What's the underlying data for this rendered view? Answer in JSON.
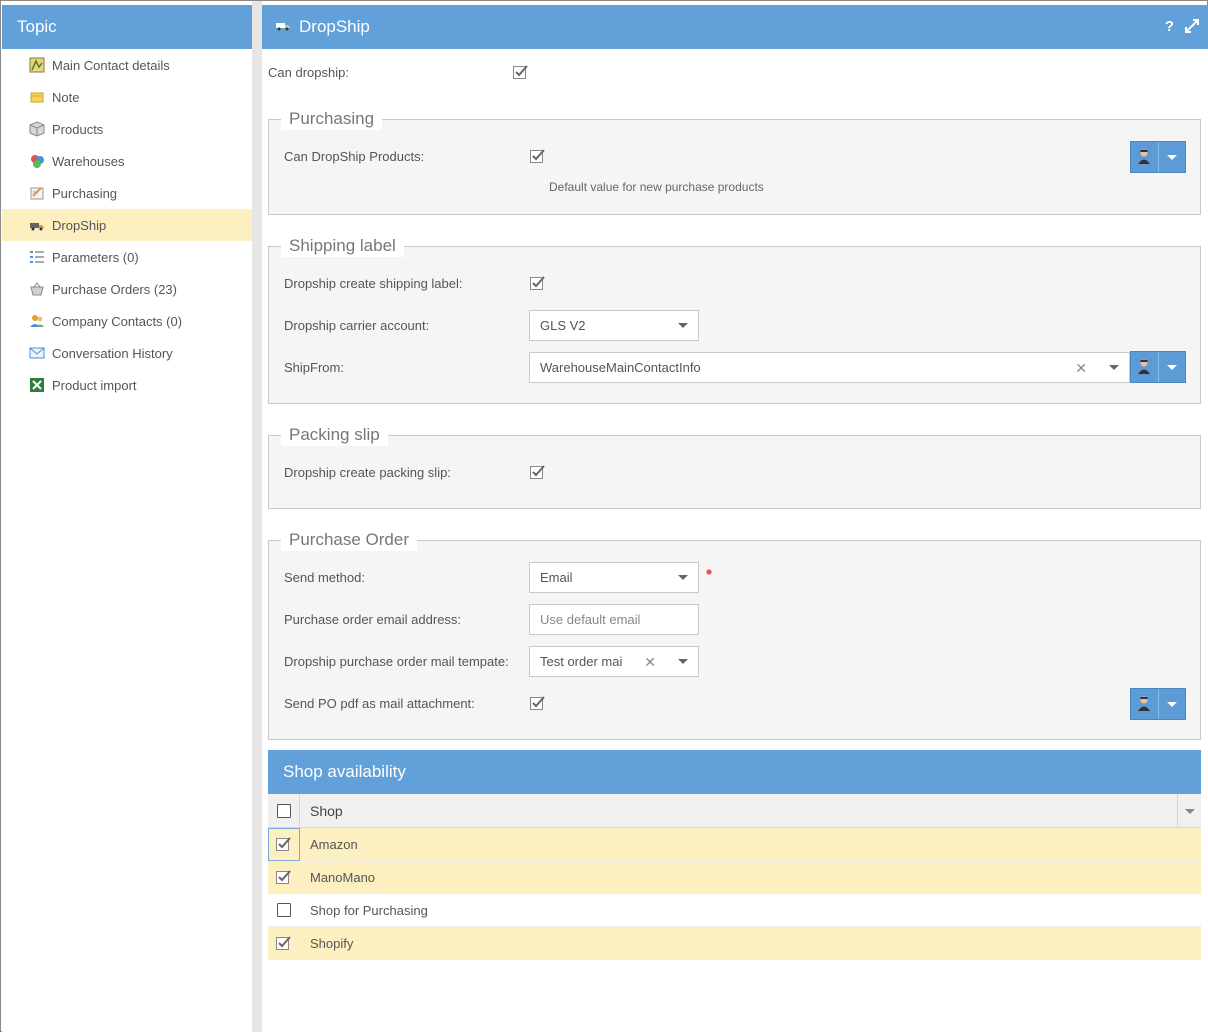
{
  "sidebar": {
    "title": "Topic",
    "items": [
      {
        "label": "Main Contact details",
        "icon": "contact-card-icon"
      },
      {
        "label": "Note",
        "icon": "note-icon"
      },
      {
        "label": "Products",
        "icon": "products-box-icon"
      },
      {
        "label": "Warehouses",
        "icon": "warehouses-icon"
      },
      {
        "label": "Purchasing",
        "icon": "purchasing-icon"
      },
      {
        "label": "DropShip",
        "icon": "truck-icon",
        "active": true
      },
      {
        "label": "Parameters (0)",
        "icon": "parameters-list-icon"
      },
      {
        "label": "Purchase Orders (23)",
        "icon": "basket-icon"
      },
      {
        "label": "Company Contacts (0)",
        "icon": "people-icon"
      },
      {
        "label": "Conversation History",
        "icon": "envelope-icon"
      },
      {
        "label": "Product import",
        "icon": "spreadsheet-icon"
      }
    ]
  },
  "header": {
    "title": "DropShip",
    "help": "?"
  },
  "can_dropship": {
    "label": "Can dropship:",
    "checked": true
  },
  "purchasing": {
    "legend": "Purchasing",
    "can_dropship_products": {
      "label": "Can DropShip Products:",
      "checked": true
    },
    "hint": "Default value for new purchase products"
  },
  "shipping_label": {
    "legend": "Shipping label",
    "create_label": {
      "label": "Dropship create shipping label:",
      "checked": true
    },
    "carrier": {
      "label": "Dropship carrier account:",
      "value": "GLS V2"
    },
    "ship_from": {
      "label": "ShipFrom:",
      "value": "WarehouseMainContactInfo"
    }
  },
  "packing_slip": {
    "legend": "Packing slip",
    "create_slip": {
      "label": "Dropship create packing slip:",
      "checked": true
    }
  },
  "purchase_order": {
    "legend": "Purchase Order",
    "send_method": {
      "label": "Send method:",
      "value": "Email"
    },
    "email": {
      "label": "Purchase order email address:",
      "placeholder": "Use default email"
    },
    "mail_template": {
      "label": "Dropship purchase order mail tempate:",
      "value": "Test order mai"
    },
    "pdf_attachment": {
      "label": "Send PO pdf as mail attachment:",
      "checked": true
    }
  },
  "shop_availability": {
    "title": "Shop availability",
    "column": "Shop",
    "rows": [
      {
        "name": "Amazon",
        "checked": true
      },
      {
        "name": "ManoMano",
        "checked": true
      },
      {
        "name": "Shop for Purchasing",
        "checked": false
      },
      {
        "name": "Shopify",
        "checked": true
      }
    ]
  },
  "colors": {
    "header_blue": "#62a0d9",
    "selected_row": "#fcefc0",
    "required": "#e64a4a"
  }
}
